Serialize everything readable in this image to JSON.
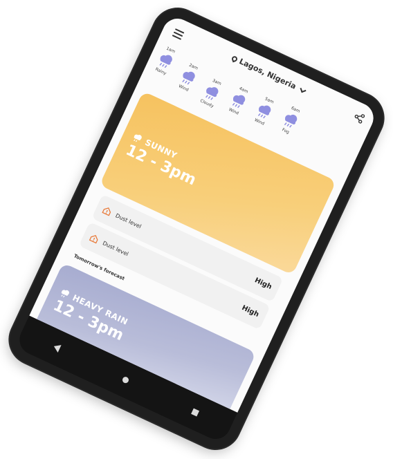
{
  "header": {
    "location": "Lagos, Nigeria"
  },
  "hourly": [
    {
      "time": "1am",
      "condition": "Rainy"
    },
    {
      "time": "2am",
      "condition": "Wind"
    },
    {
      "time": "3am",
      "condition": "Cloudy"
    },
    {
      "time": "4am",
      "condition": "Wind"
    },
    {
      "time": "5am",
      "condition": "Wind"
    },
    {
      "time": "6am",
      "condition": "Fog"
    }
  ],
  "today": {
    "condition": "SUNNY",
    "time_range": "12 - 3pm"
  },
  "dust": [
    {
      "label": "Dust level",
      "level": "High"
    },
    {
      "label": "Dust level",
      "level": "High"
    }
  ],
  "tomorrow": {
    "section_label": "Tomorrow's forecast",
    "condition": "HEAVY RAIN",
    "time_range": "12 - 3pm"
  },
  "colors": {
    "sunny_card": "#f6c25f",
    "rain_card": "#a7acd0",
    "cloud_icon": "#8f8fe0",
    "dust_icon": "#e87a3a"
  },
  "icons": {
    "menu": "hamburger-icon",
    "location": "location-pin-icon",
    "share": "share-icon",
    "hourly": "rain-cloud-icon",
    "weather": "weather-icon",
    "dust": "house-warning-icon"
  }
}
